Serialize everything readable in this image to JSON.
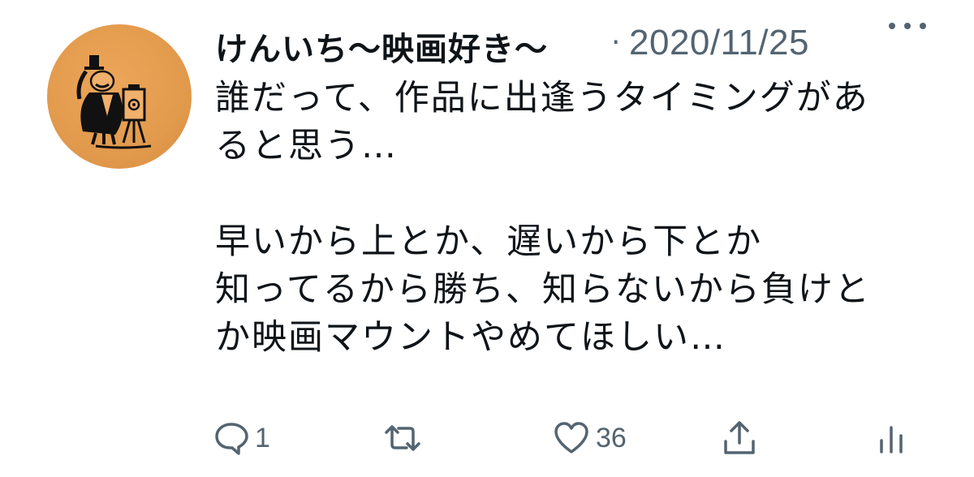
{
  "tweet": {
    "display_name": "けんいち〜映画好き〜",
    "separator": "·",
    "timestamp": "2020/11/25",
    "text": "誰だって、作品に出逢うタイミングがあると思う…\n\n早いから上とか、遅いから下とか\n知ってるから勝ち、知らないから負けとか映画マウントやめてほしい…",
    "text_lines": [
      "誰だって、作品に出逢うタイミングがあ",
      "ると思う…",
      "",
      "早いから上とか、遅いから下とか",
      "知ってるから勝ち、知らないから負けと",
      "か映画マウントやめてほしい…"
    ]
  },
  "actions": {
    "reply": {
      "icon": "reply-icon",
      "count": "1"
    },
    "retweet": {
      "icon": "retweet-icon",
      "count": ""
    },
    "like": {
      "icon": "heart-icon",
      "count": "36"
    },
    "share": {
      "icon": "share-icon",
      "count": ""
    },
    "analytics": {
      "icon": "analytics-icon",
      "count": ""
    }
  },
  "more": {
    "icon": "more-icon"
  },
  "colors": {
    "text": "#0f1419",
    "secondary": "#536471",
    "avatar_bg": "#e29a4d"
  }
}
